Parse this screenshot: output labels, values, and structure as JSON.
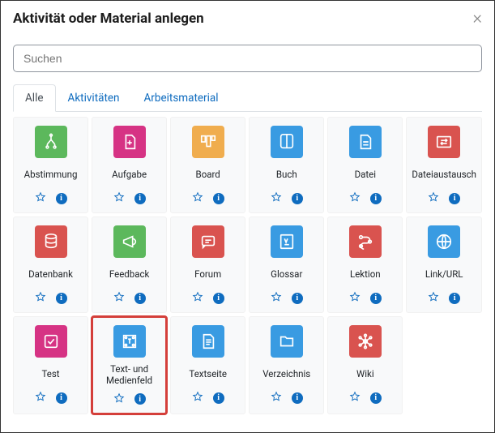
{
  "header": {
    "title": "Aktivität oder Material anlegen",
    "close": "×"
  },
  "search": {
    "placeholder": "Suchen"
  },
  "tabs": [
    {
      "label": "Alle",
      "active": true
    },
    {
      "label": "Aktivitäten",
      "active": false
    },
    {
      "label": "Arbeitsmaterial",
      "active": false
    }
  ],
  "info_glyph": "i",
  "activities": [
    {
      "name": "abstimmung",
      "label": "Abstimmung",
      "color": "c-green",
      "icon": "fork",
      "highlighted": false
    },
    {
      "name": "aufgabe",
      "label": "Aufgabe",
      "color": "c-pink",
      "icon": "file-plus",
      "highlighted": false
    },
    {
      "name": "board",
      "label": "Board",
      "color": "c-orange",
      "icon": "kanban",
      "highlighted": false
    },
    {
      "name": "buch",
      "label": "Buch",
      "color": "c-blue",
      "icon": "book",
      "highlighted": false
    },
    {
      "name": "datei",
      "label": "Datei",
      "color": "c-blue",
      "icon": "file",
      "highlighted": false
    },
    {
      "name": "dateiaustausch",
      "label": "Dateiaustausch",
      "color": "c-red",
      "icon": "exchange",
      "highlighted": false
    },
    {
      "name": "datenbank",
      "label": "Datenbank",
      "color": "c-red",
      "icon": "db",
      "highlighted": false
    },
    {
      "name": "feedback",
      "label": "Feedback",
      "color": "c-green",
      "icon": "megaphone",
      "highlighted": false
    },
    {
      "name": "forum",
      "label": "Forum",
      "color": "c-red",
      "icon": "chat",
      "highlighted": false
    },
    {
      "name": "glossar",
      "label": "Glossar",
      "color": "c-blue",
      "icon": "glossar",
      "highlighted": false
    },
    {
      "name": "lektion",
      "label": "Lektion",
      "color": "c-red",
      "icon": "path",
      "highlighted": false
    },
    {
      "name": "linkurl",
      "label": "Link/URL",
      "color": "c-blue",
      "icon": "globe",
      "highlighted": false
    },
    {
      "name": "test",
      "label": "Test",
      "color": "c-pink",
      "icon": "check",
      "highlighted": false
    },
    {
      "name": "text-medienfeld",
      "label": "Text- und Medienfeld",
      "color": "c-blue",
      "icon": "textfield",
      "highlighted": true
    },
    {
      "name": "textseite",
      "label": "Textseite",
      "color": "c-blue",
      "icon": "page",
      "highlighted": false
    },
    {
      "name": "verzeichnis",
      "label": "Verzeichnis",
      "color": "c-blue",
      "icon": "folder",
      "highlighted": false
    },
    {
      "name": "wiki",
      "label": "Wiki",
      "color": "c-red",
      "icon": "network",
      "highlighted": false
    }
  ]
}
